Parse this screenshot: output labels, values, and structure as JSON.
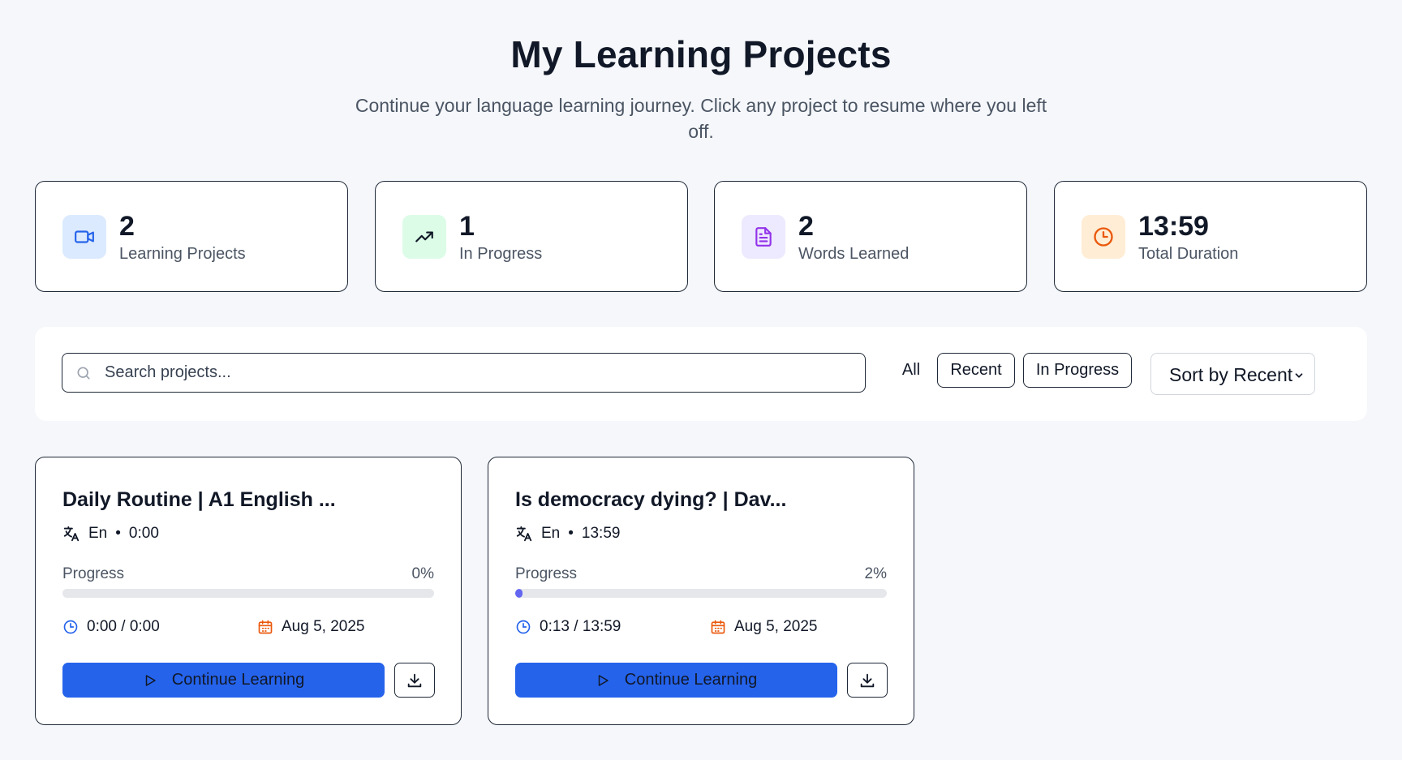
{
  "header": {
    "title": "My Learning Projects",
    "subtitle": "Continue your language learning journey. Click any project to resume where you left off."
  },
  "stats": [
    {
      "value": "2",
      "label": "Learning Projects",
      "icon": "video-icon",
      "color": "#2563eb",
      "bg": "#dbeafe"
    },
    {
      "value": "1",
      "label": "In Progress",
      "icon": "trending-up-icon",
      "color": "#111827",
      "bg": "#dcfce7"
    },
    {
      "value": "2",
      "label": "Words Learned",
      "icon": "document-icon",
      "color": "#9333ea",
      "bg": "#ede9fe"
    },
    {
      "value": "13:59",
      "label": "Total Duration",
      "icon": "clock-icon",
      "color": "#ea580c",
      "bg": "#ffedd5"
    }
  ],
  "toolbar": {
    "search_placeholder": "Search projects...",
    "filters": [
      "All",
      "Recent",
      "In Progress"
    ],
    "sort_label": "Sort by Recent"
  },
  "projects": [
    {
      "title": "Daily Routine  |  A1 English ...",
      "language": "En",
      "duration": "0:00",
      "progress_label": "Progress",
      "progress_pct": "0%",
      "progress": 0,
      "time": "0:00 / 0:00",
      "date": "Aug 5, 2025",
      "cta": "Continue Learning"
    },
    {
      "title": "Is democracy dying?   |  Dav...",
      "language": "En",
      "duration": "13:59",
      "progress_label": "Progress",
      "progress_pct": "2%",
      "progress": 0.02,
      "time": "0:13 / 13:59",
      "date": "Aug 5, 2025",
      "cta": "Continue Learning"
    }
  ],
  "colors": {
    "accent": "#2563eb",
    "progress_fill": "#6366f1",
    "clock_blue": "#2563eb",
    "calendar_orange": "#ea580c"
  }
}
